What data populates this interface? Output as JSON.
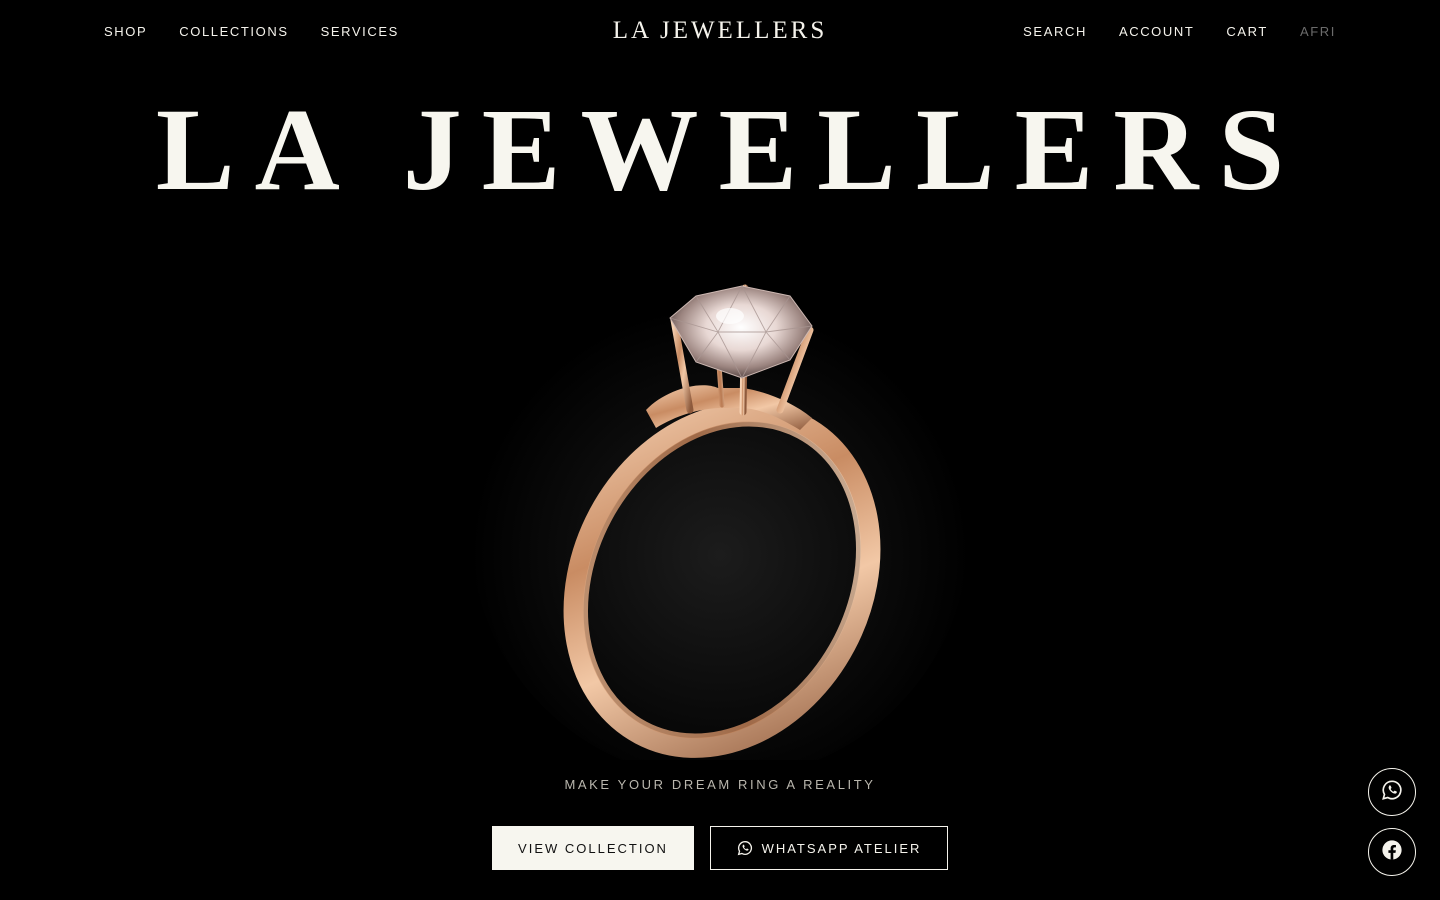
{
  "nav": {
    "left_links": [
      "SHOP",
      "COLLECTIONS",
      "SERVICES"
    ],
    "logo": "LA JEWELLERS",
    "right_links": [
      "SEARCH",
      "ACCOUNT",
      "CART"
    ],
    "language": "AFRI"
  },
  "hero": {
    "title": "LA JEWELLERS",
    "tagline": "MAKE YOUR DREAM RING A REALITY",
    "image": "rose-gold-solitaire-diamond-ring"
  },
  "cta": {
    "primary_label": "VIEW COLLECTION",
    "secondary_label": "WHATSAPP ATELIER",
    "secondary_icon": "whatsapp-icon"
  },
  "floating": {
    "whatsapp_icon": "whatsapp-icon",
    "facebook_icon": "facebook-icon"
  },
  "colors": {
    "background": "#000000",
    "text": "#f5f3ec",
    "muted": "#6b6b6b",
    "primary_button": "#f7f6ef",
    "rose_gold": "#d9a07a"
  }
}
